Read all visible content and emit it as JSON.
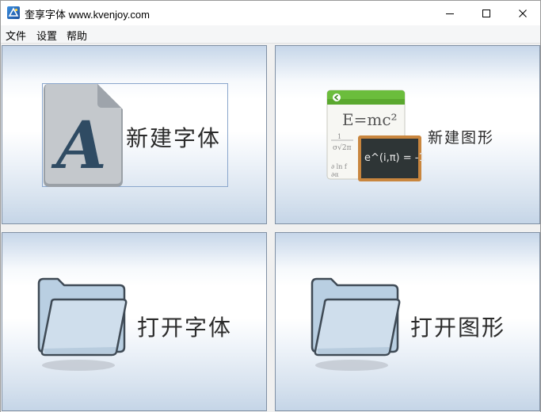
{
  "window": {
    "title": "奎享字体 www.kvenjoy.com",
    "app_icon": "app-logo-icon",
    "controls": [
      "minimize-icon",
      "maximize-icon",
      "close-icon"
    ]
  },
  "menu": {
    "items": [
      {
        "label": "文件"
      },
      {
        "label": "设置"
      },
      {
        "label": "帮助"
      }
    ]
  },
  "panels": {
    "new_font": {
      "label": "新建字体",
      "icon": "font-file-icon"
    },
    "new_graphic": {
      "label": "新建图形",
      "icon": "formula-board-icon",
      "formula": "E=mc²",
      "board_text": "e^(i,π) = -1"
    },
    "open_font": {
      "label": "打开字体",
      "icon": "folder-icon"
    },
    "open_graphic": {
      "label": "打开图形",
      "icon": "folder-icon"
    }
  },
  "colors": {
    "panel_border": "#7f8fa3",
    "panel_gradient_edge": "#c5d5e7",
    "label_text": "#2b2b2b"
  }
}
